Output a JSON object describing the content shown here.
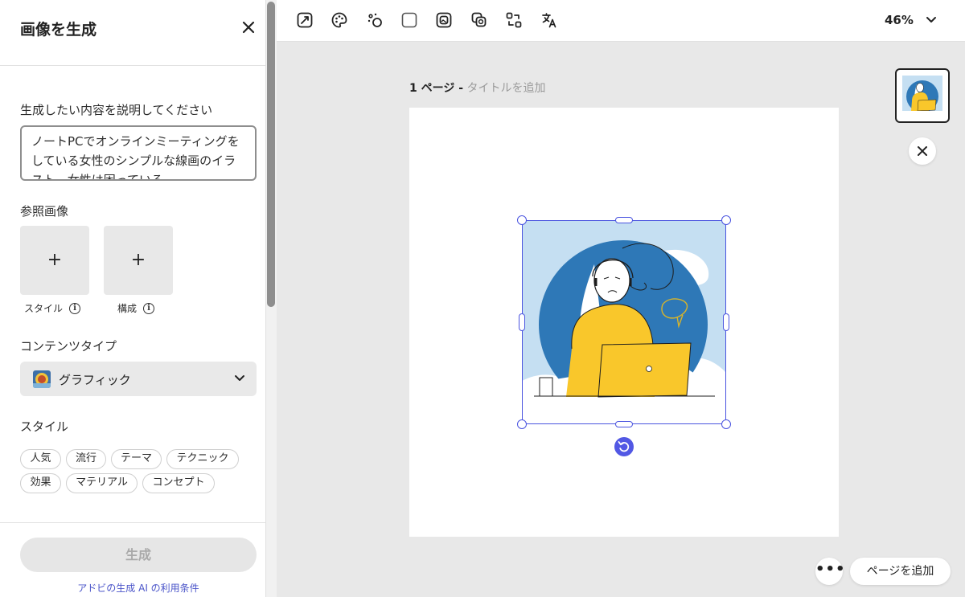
{
  "panel": {
    "title": "画像を生成",
    "close_icon": "close-icon",
    "prompt_label": "生成したい内容を説明してください",
    "prompt_value": "ノートPCでオンラインミーティングをしている女性のシンプルな線画のイラスト、女性は困っている。",
    "reference_label": "参照画像",
    "reference_tiles": [
      {
        "caption": "スタイル",
        "icon": "plus-icon",
        "info_icon": "info-icon"
      },
      {
        "caption": "構成",
        "icon": "plus-icon",
        "info_icon": "info-icon"
      }
    ],
    "content_type_label": "コンテンツタイプ",
    "content_type_value": "グラフィック",
    "style_label": "スタイル",
    "style_chips": [
      "人気",
      "流行",
      "テーマ",
      "テクニック",
      "効果",
      "マテリアル",
      "コンセプト"
    ],
    "generate_button": "生成",
    "terms_link": "アドビの生成 AI の利用条件"
  },
  "toolbar": {
    "icons": [
      "resize-icon",
      "palette-icon",
      "effects-icon",
      "shape-icon",
      "image-icon",
      "duplicate-icon",
      "swap-icon",
      "translate-icon"
    ],
    "zoom": "46%"
  },
  "canvas": {
    "page_number": "1 ページ -",
    "page_title_placeholder": "タイトルを追加"
  },
  "actions": {
    "more_icon": "more-icon",
    "more_label": "•••",
    "add_page": "ページを追加",
    "close_label": "✕"
  },
  "colors": {
    "accent": "#4a54e0",
    "illustration_blue": "#2e78b7",
    "illustration_yellow": "#f9c72b",
    "illustration_light": "#c5dff2"
  }
}
